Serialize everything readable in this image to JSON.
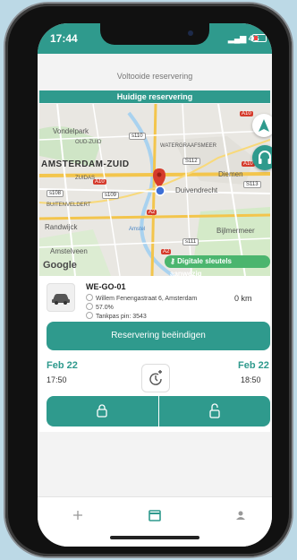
{
  "status": {
    "time": "17:44",
    "network": "4G"
  },
  "header": {
    "completed_label": "Voltooide reservering",
    "current_label": "Huidige reservering"
  },
  "map": {
    "labels": {
      "vondelpark": "Vondelpark",
      "oud_zuid": "OUD-ZUID",
      "watergraafsmeer": "WATERGRAAFSMEER",
      "amsterdam_zuid": "AMSTERDAM-ZUID",
      "zuidas": "ZUIDAS",
      "buitenveldert": "BUITENVELDERT",
      "diemen": "Diemen",
      "duivendrecht": "Duivendrecht",
      "randwijck": "Randwijck",
      "bijlmermeer": "Bijlmermeer",
      "amstelveen": "Amstelveen",
      "amstel": "Amstel",
      "google": "Google"
    },
    "road_badges": [
      "s110",
      "S112",
      "s108",
      "s109",
      "S113",
      "s111"
    ],
    "red_badges": [
      "A10",
      "A10",
      "A10",
      "A2",
      "A2"
    ],
    "digital_keys_label": "Digitale sleutels aanwezig"
  },
  "reservation": {
    "plate": "WE-GO-01",
    "address": "Willem Fenengastraat  6, Amsterdam",
    "fuel": "57.0%",
    "tank_pin": "Tankpas pin: 3543",
    "distance": "0 km",
    "end_button_label": "Reservering beëindigen",
    "start_date": "Feb 22",
    "start_time": "17:50",
    "end_date": "Feb 22",
    "end_time": "18:50"
  },
  "colors": {
    "accent": "#2f9a8d",
    "keys_badge": "#4bb56e",
    "pin": "#d53b2c"
  },
  "icons": [
    "navigation-arrow-icon",
    "headset-icon",
    "car-icon",
    "location-icon",
    "fuel-icon",
    "card-icon",
    "extend-time-icon",
    "lock-icon",
    "unlock-icon",
    "plus-icon",
    "calendar-icon",
    "person-icon"
  ]
}
